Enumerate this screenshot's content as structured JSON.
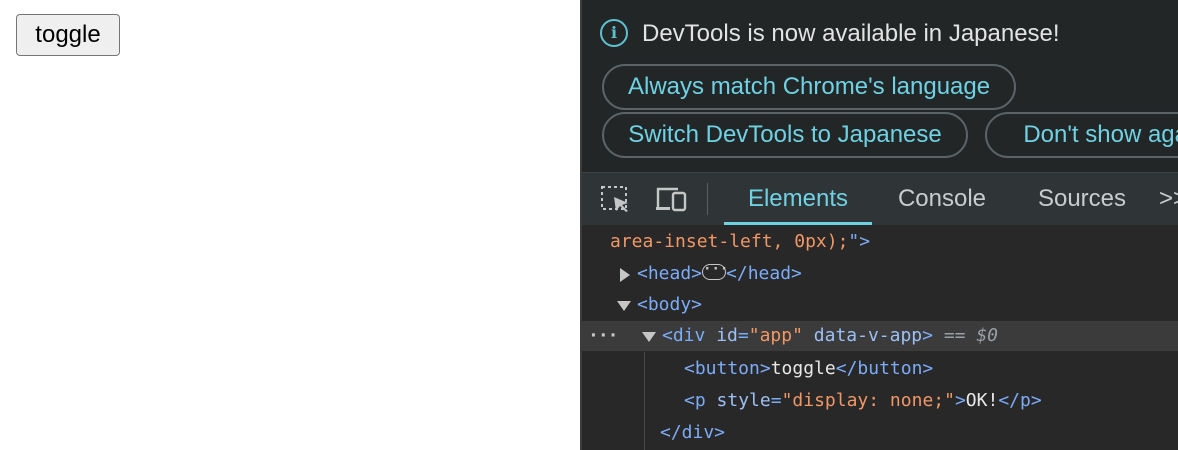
{
  "page": {
    "toggle_button_label": "toggle"
  },
  "devtools": {
    "infobar": {
      "icon": "info-icon",
      "message": "DevTools is now available in Japanese!",
      "buttons": [
        "Always match Chrome's language",
        "Switch DevTools to Japanese",
        "Don't show again"
      ]
    },
    "toolbar": {
      "tabs": [
        "Elements",
        "Console",
        "Sources"
      ],
      "active_tab": "Elements",
      "more_label": ">>"
    },
    "dom_tree": {
      "line0_val": "area-inset-left, 0px);",
      "line0_tail": "\">",
      "head_open": "<head>",
      "head_close": "</head>",
      "body_open": "<body>",
      "div_open_tag": "<div",
      "div_attr_id": "id",
      "div_attr_id_val": "\"app\"",
      "div_attr_data": "data-v-app",
      "div_close_bracket": ">",
      "selected_marker": "== $0",
      "button_open": "<button>",
      "button_text": "toggle",
      "button_close": "</button>",
      "p_open": "<p",
      "p_attr": "style",
      "p_attr_val": "\"display: none;\"",
      "p_gt": ">",
      "p_text": "OK!",
      "p_close": "</p>",
      "div_close": "</div>"
    },
    "colors": {
      "accent": "#6fd2e4",
      "tag": "#7cacf8",
      "attr_value": "#f29766",
      "panel_bg": "#282828"
    }
  }
}
